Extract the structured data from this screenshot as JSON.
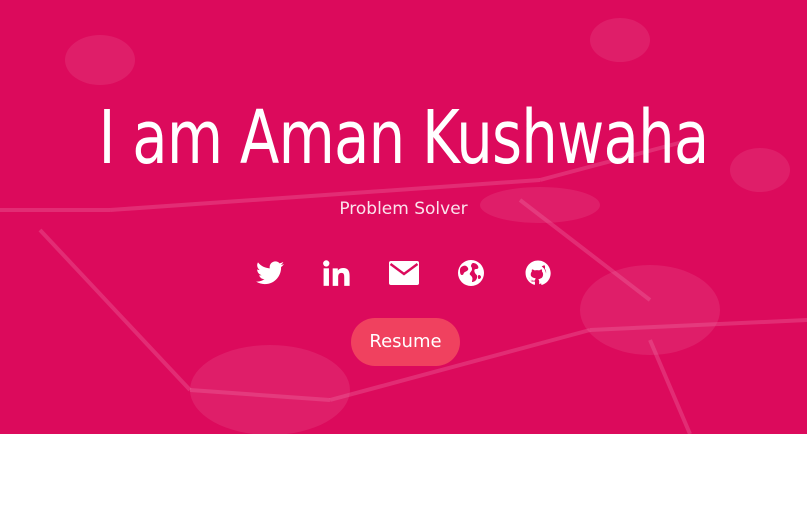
{
  "hero": {
    "title": "I am Aman Kushwaha",
    "subtitle": "Problem Solver",
    "background_color": "#dc0a5c"
  },
  "social": [
    {
      "name": "twitter",
      "icon": "twitter-icon"
    },
    {
      "name": "linkedin",
      "icon": "linkedin-icon"
    },
    {
      "name": "email",
      "icon": "envelope-icon"
    },
    {
      "name": "website",
      "icon": "globe-icon"
    },
    {
      "name": "github",
      "icon": "github-icon"
    }
  ],
  "resume_button": {
    "label": "Resume",
    "color": "#f0415f"
  }
}
